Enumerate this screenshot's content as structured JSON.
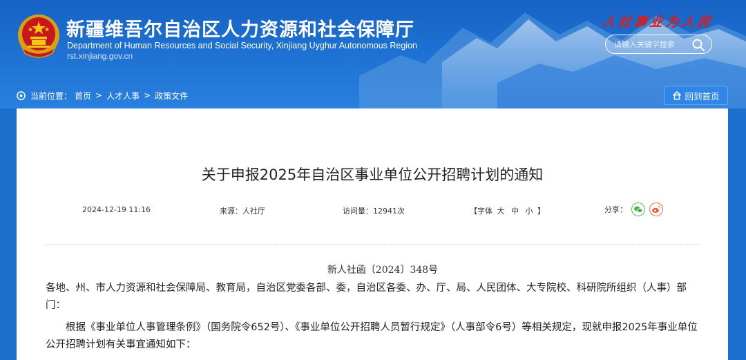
{
  "header": {
    "site_title": "新疆维吾尔自治区人力资源和社会保障厅",
    "site_subtitle": "Department of Human Resources and Social Security, Xinjiang Uyghur Autonomous Region",
    "site_url": "rst.xinjiang.gov.cn",
    "slogan": "人社事业为人民",
    "search": {
      "placeholder": "请输入关键字搜索",
      "icon": "search-icon"
    },
    "colors": {
      "banner": "#1f73d4",
      "slogan": "#d81e1e"
    }
  },
  "breadcrumb": {
    "label": "当前位置：",
    "items": [
      "首页",
      "人才人事",
      "政策文件"
    ],
    "separator": ">",
    "icon": "location-icon"
  },
  "back_home": {
    "label": "回到首页",
    "icon": "home-icon"
  },
  "article": {
    "title": "关于申报2025年自治区事业单位公开招聘计划的通知",
    "date": "2024-12-19 11:16",
    "source": "来源：人社厅",
    "views": "访问量：12941次",
    "font_size": {
      "open": "【字体",
      "large": "大",
      "medium": "中",
      "small": "小",
      "close": "】"
    },
    "share_label": "分享：",
    "share_icons": [
      "wechat-icon",
      "weibo-icon"
    ],
    "doc_number": "新人社函〔2024〕348号",
    "paragraphs": [
      "各地、州、市人力资源和社会保障局、教育局，自治区党委各部、委，自治区各委、办、厅、局、人民团体、大专院校、科研院所组织（人事）部门：",
      "根据《事业单位人事管理条例》（国务院令652号）、《事业单位公开招聘人员暂行规定》（人事部令6号）等相关规定，现就申报2025年事业单位公开招聘计划有关事宜通知如下："
    ]
  }
}
